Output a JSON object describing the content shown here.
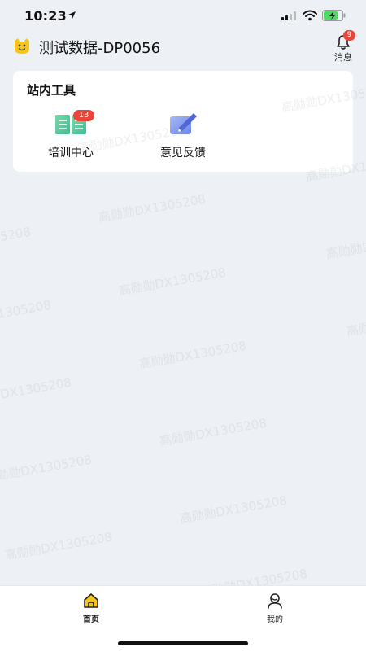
{
  "status_bar": {
    "time": "10:23"
  },
  "header": {
    "title": "测试数据-DP0056",
    "messages_label": "消息",
    "messages_badge": "9"
  },
  "tools_card": {
    "title": "站内工具",
    "items": [
      {
        "label": "培训中心",
        "badge": "13",
        "icon": "book-icon"
      },
      {
        "label": "意见反馈",
        "badge": "",
        "icon": "edit-icon"
      }
    ]
  },
  "watermark": {
    "text": "高勋勋DX1305208"
  },
  "tab_bar": {
    "items": [
      {
        "label": "首页",
        "icon": "home-icon",
        "active": true
      },
      {
        "label": "我的",
        "icon": "user-icon",
        "active": false
      }
    ]
  },
  "colors": {
    "accent": "#f5c518",
    "badge": "#e8463b",
    "background": "#edf0f4"
  }
}
